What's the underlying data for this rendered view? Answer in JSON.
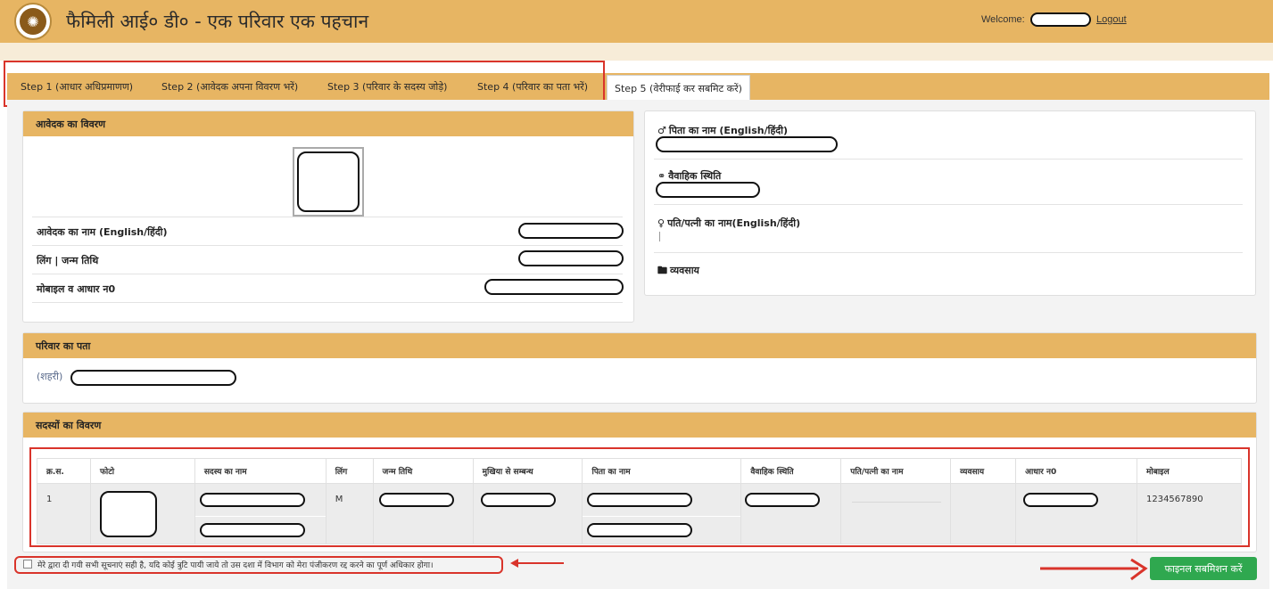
{
  "header": {
    "title": "फैमिली आई० डी० - एक परिवार एक पहचान",
    "welcome_label": "Welcome:",
    "logout_label": "Logout"
  },
  "tabs": [
    {
      "label": "Step 1 (आधार अधिप्रमाणण)",
      "active": false
    },
    {
      "label": "Step 2 (आवेदक अपना विवरण भरें)",
      "active": false
    },
    {
      "label": "Step 3 (परिवार के सदस्य जोड़े)",
      "active": false
    },
    {
      "label": "Step 4 (परिवार का पता भरें)",
      "active": false
    },
    {
      "label": "Step 5 (वेरीफाई कर सबमिट करें)",
      "active": true
    }
  ],
  "applicant": {
    "title": "आवेदक का विवरण",
    "name_label": "आवेदक का नाम (English/हिंदी)",
    "gender_dob_label": "लिंग | जन्म तिथि",
    "mobile_aadhaar_label": "मोबाइल व आधार न0"
  },
  "family_info": {
    "father_label": "पिता का नाम (English/हिंदी)",
    "marital_label": "वैवाहिक स्थिति",
    "spouse_label": "पति/पत्नी का नाम(English/हिंदी)",
    "occupation_label": "व्यवसाय"
  },
  "address": {
    "title": "परिवार का पता",
    "type": "(शहरी)"
  },
  "members": {
    "title": "सदस्यों का विवरण",
    "columns": [
      "क्र.स.",
      "फोटो",
      "सदस्य का नाम",
      "लिंग",
      "जन्म तिथि",
      "मुखिया से सम्बन्ध",
      "पिता का नाम",
      "वैवाहिक स्थिति",
      "पति/पत्नी का नाम",
      "व्यवसाय",
      "आधार न0",
      "मोबाइल"
    ],
    "rows": [
      {
        "sno": "1",
        "gender": "M",
        "mobile": "1234567890"
      }
    ]
  },
  "declaration": {
    "text": "मेरे द्वारा दी गयी सभी सूचनाएं सही है, यदि कोई त्रुटि पायी जाये तो उस दशा में विभाग को मेरा पंजीकरण रद्द करने का पूर्ण अधिकार होगा।"
  },
  "submit": {
    "label": "फाइनल सबमिशन करें"
  },
  "colors": {
    "header": "#e7b563",
    "highlight": "#d9342b",
    "submit": "#2fa84f"
  }
}
